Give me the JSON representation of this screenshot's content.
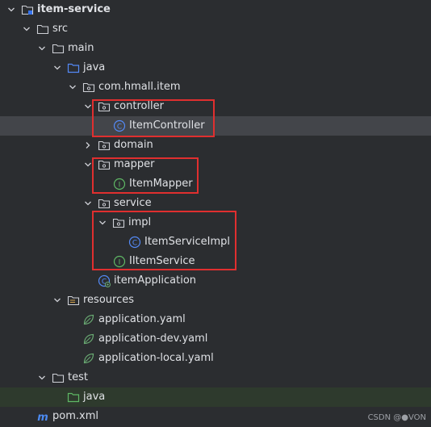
{
  "project": {
    "root": "item-service"
  },
  "tree": {
    "src": "src",
    "main": "main",
    "java": "java",
    "package": "com.hmall.item",
    "controller": "controller",
    "item_controller": "ItemController",
    "domain": "domain",
    "mapper": "mapper",
    "item_mapper": "ItemMapper",
    "service": "service",
    "impl": "impl",
    "item_service_impl": "ItemServiceImpl",
    "iitem_service": "IItemService",
    "item_application": "itemApplication",
    "resources": "resources",
    "application_yaml": "application.yaml",
    "application_dev_yaml": "application-dev.yaml",
    "application_local_yaml": "application-local.yaml",
    "test": "test",
    "test_java": "java",
    "pom": "pom.xml"
  },
  "watermark": "CSDN @●VON",
  "colors": {
    "background": "#2b2d30",
    "selected_row": "#43454a",
    "highlight_box": "#e02f2f",
    "class_icon": "#548af7",
    "interface_icon": "#5fb865",
    "maven_icon": "#4c8af0",
    "spring_leaf": "#6aab73"
  }
}
